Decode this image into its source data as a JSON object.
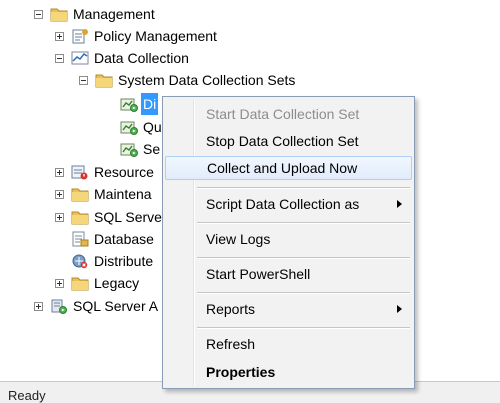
{
  "tree": {
    "management": "Management",
    "policy_management": "Policy Management",
    "data_collection": "Data Collection",
    "system_data_collection_sets": "System Data Collection Sets",
    "dc_item_1": "Di",
    "dc_item_2": "Qu",
    "dc_item_3": "Se",
    "resource": "Resource",
    "maintenance": "Maintena",
    "sql_server_logs": "SQL Serve",
    "database_mail": "Database",
    "distributed": "Distribute",
    "legacy": "Legacy",
    "sql_server_agent": "SQL Server A"
  },
  "context_menu": {
    "start": "Start Data Collection Set",
    "stop": "Stop Data Collection Set",
    "collect": "Collect and Upload Now",
    "script": "Script Data Collection as",
    "view_logs": "View Logs",
    "powershell": "Start PowerShell",
    "reports": "Reports",
    "refresh": "Refresh",
    "properties": "Properties"
  },
  "status": {
    "text": "Ready"
  },
  "icons": {
    "folder": "folder-icon",
    "policy": "policy-management-icon",
    "data_collection": "data-collection-chart-icon",
    "collection_set": "collection-set-icon",
    "resource_governor": "resource-governor-icon",
    "database_mail": "database-mail-icon",
    "dtc": "distributed-transaction-icon",
    "agent": "sql-server-agent-icon"
  }
}
